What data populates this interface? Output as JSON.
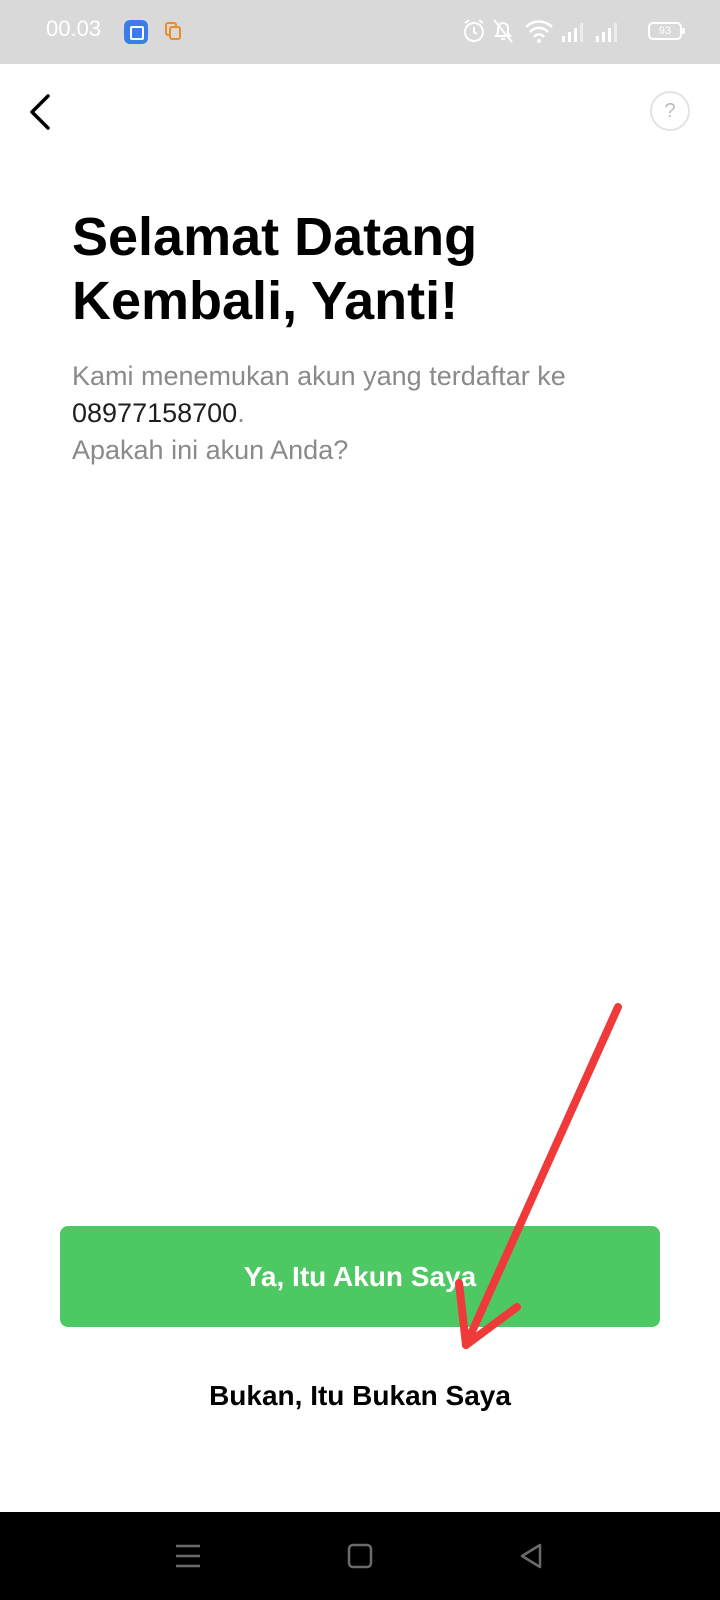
{
  "status_bar": {
    "time": "00.03",
    "battery": "93",
    "icons": [
      "app-notification-icon",
      "copy-icon",
      "alarm-icon",
      "mute-icon",
      "wifi-icon",
      "signal-icon",
      "signal-icon-2",
      "battery-icon"
    ]
  },
  "header": {
    "back_icon": "chevron-left-icon",
    "help_label": "?"
  },
  "main": {
    "title_line1": "Selamat Datang",
    "title_line2": "Kembali, Yanti!",
    "desc_line1": "Kami menemukan akun yang terdaftar ke",
    "phone": "08977158700",
    "phone_suffix": ".",
    "desc_line3": "Apakah ini akun Anda?"
  },
  "actions": {
    "primary_label": "Ya, Itu Akun Saya",
    "secondary_label": "Bukan, Itu Bukan Saya"
  },
  "annotation": {
    "color": "#f03a3a",
    "icon": "red-arrow-annotation"
  },
  "navigation_bar": {
    "icons": [
      "menu-icon",
      "home-square-icon",
      "back-triangle-icon"
    ]
  },
  "colors": {
    "primary_button": "#4ec863",
    "status_bar": "#d9d9d9"
  }
}
